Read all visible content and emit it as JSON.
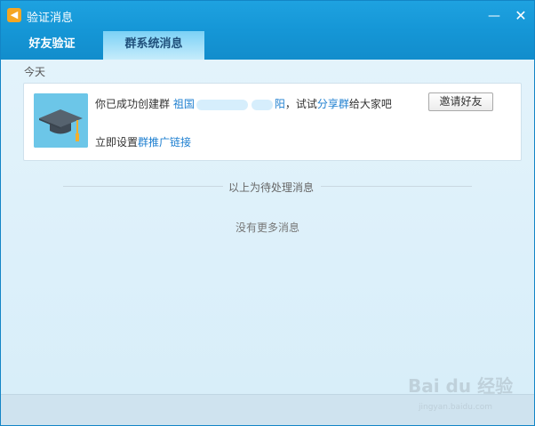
{
  "window": {
    "title": "验证消息",
    "minimize_icon": "minimize-icon",
    "close_icon": "close-icon"
  },
  "tabs": [
    {
      "label": "好友验证",
      "active": false
    },
    {
      "label": "群系统消息",
      "active": true
    }
  ],
  "section": {
    "label": "今天"
  },
  "message": {
    "text_prefix": "你已成功创建群 ",
    "group_name_start": "祖国",
    "group_name_end": "阳",
    "text_middle": "，试试",
    "share_link": "分享群",
    "text_suffix": "给大家吧",
    "sub_prefix": "立即设置",
    "promo_link": "群推广链接",
    "invite_button": "邀请好友",
    "avatar_icon": "graduation-cap-icon"
  },
  "divider": {
    "label": "以上为待处理消息"
  },
  "footer": {
    "no_more": "没有更多消息"
  },
  "watermark": {
    "main": "Bai du 经验",
    "sub": "jingyan.baidu.com"
  },
  "colors": {
    "titlebar": "#1596d6",
    "active_tab": "#c6ecfb",
    "link": "#1e7fd0"
  }
}
